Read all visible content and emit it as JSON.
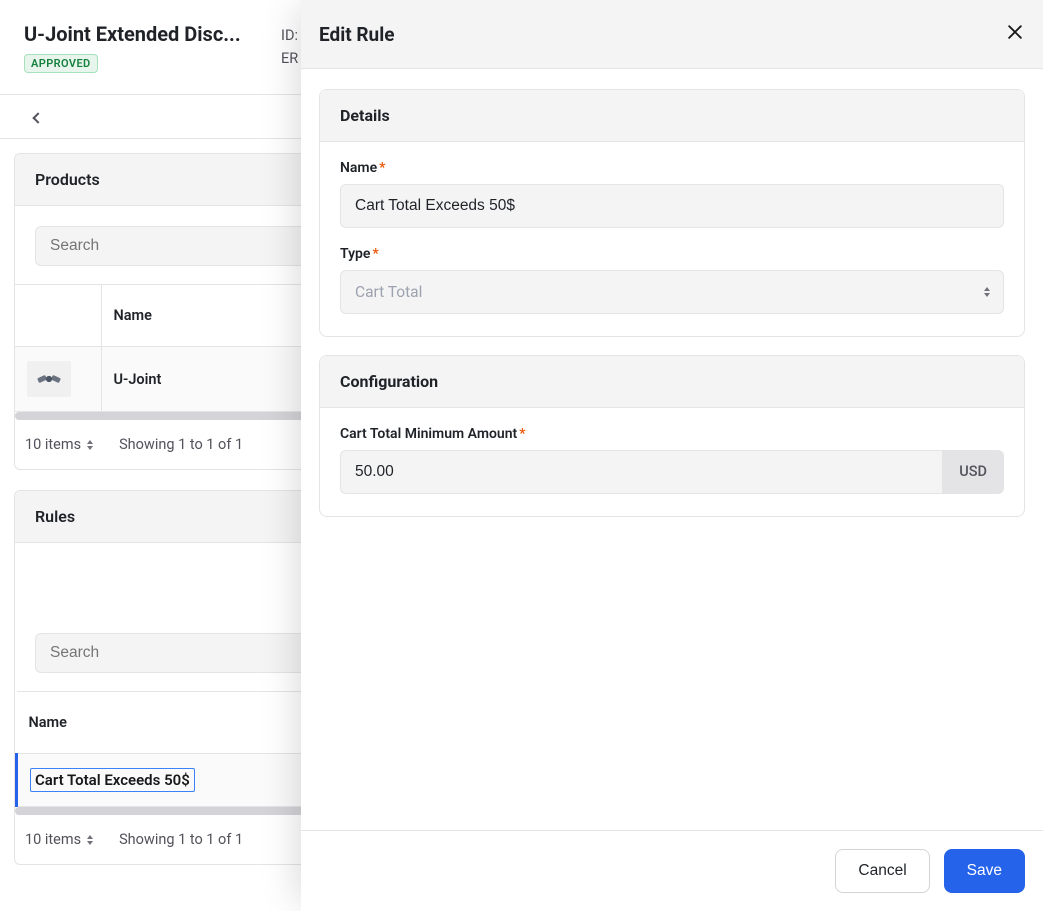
{
  "header": {
    "title": "U-Joint Extended Disc...",
    "status_badge": "APPROVED",
    "meta_id_label": "ID:",
    "meta_erp_label": "ER"
  },
  "products": {
    "panel_title": "Products",
    "search_placeholder": "Search",
    "columns": {
      "name": "Name"
    },
    "rows": [
      {
        "name": "U-Joint"
      }
    ],
    "pager_items": "10 items",
    "pager_showing": "Showing 1 to 1 of 1"
  },
  "rules": {
    "panel_title": "Rules",
    "search_placeholder": "Search",
    "columns": {
      "name": "Name"
    },
    "rows": [
      {
        "name": "Cart Total Exceeds 50$"
      }
    ],
    "pager_items": "10 items",
    "pager_showing": "Showing 1 to 1 of 1"
  },
  "drawer": {
    "title": "Edit Rule",
    "details": {
      "heading": "Details",
      "name_label": "Name",
      "name_value": "Cart Total Exceeds 50$",
      "type_label": "Type",
      "type_value": "Cart Total"
    },
    "config": {
      "heading": "Configuration",
      "min_label": "Cart Total Minimum Amount",
      "min_value": "50.00",
      "currency": "USD"
    },
    "buttons": {
      "cancel": "Cancel",
      "save": "Save"
    }
  }
}
